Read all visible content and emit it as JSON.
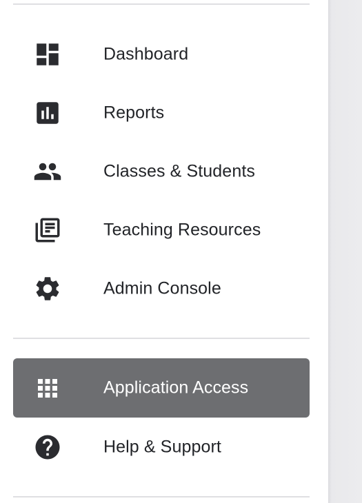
{
  "nav": {
    "primary": [
      {
        "label": "Dashboard",
        "icon": "dashboard-icon"
      },
      {
        "label": "Reports",
        "icon": "bar-chart-icon"
      },
      {
        "label": "Classes & Students",
        "icon": "people-icon"
      },
      {
        "label": "Teaching Resources",
        "icon": "library-books-icon"
      },
      {
        "label": "Admin Console",
        "icon": "gear-icon"
      }
    ],
    "secondary": [
      {
        "label": "Application Access",
        "icon": "apps-grid-icon",
        "active": true
      },
      {
        "label": "Help & Support",
        "icon": "help-circle-icon"
      }
    ]
  },
  "colors": {
    "active_background": "#6d6e71",
    "text": "#222428",
    "icon": "#2b2c30",
    "divider": "#dfdfe2"
  }
}
